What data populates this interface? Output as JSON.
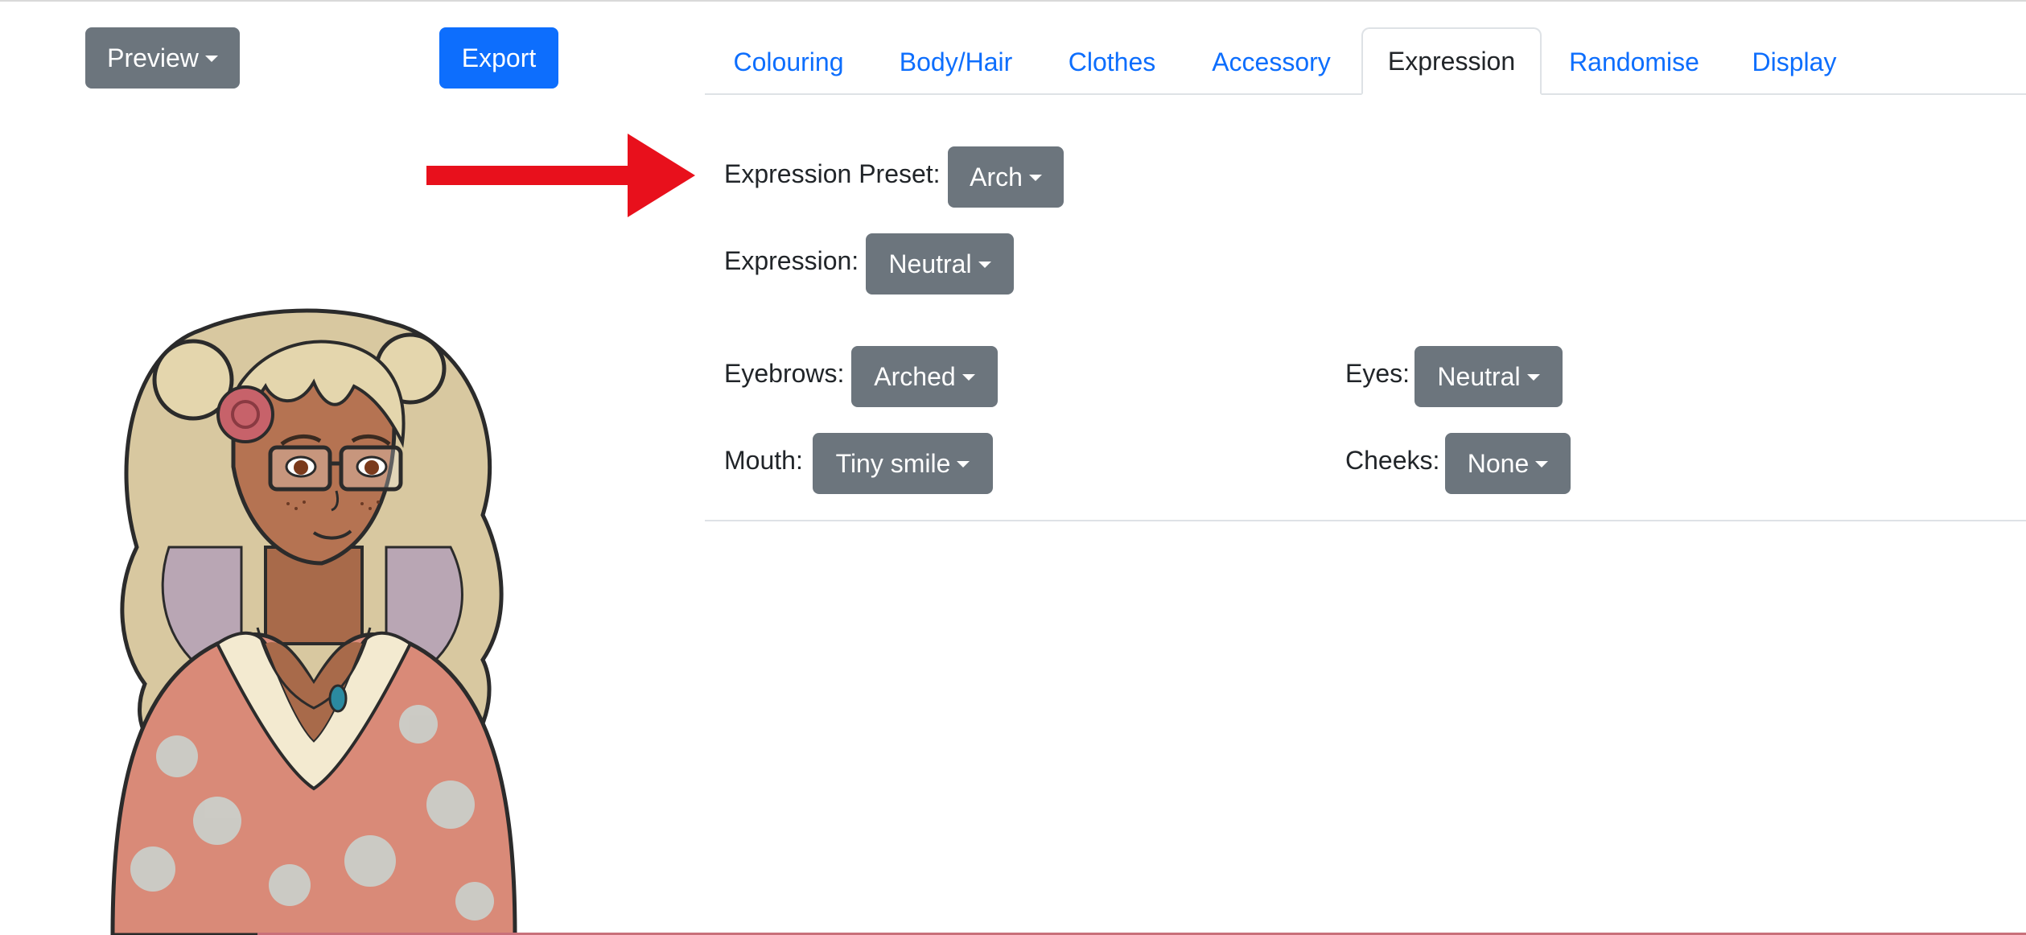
{
  "toolbar": {
    "preview_label": "Preview",
    "export_label": "Export"
  },
  "tabs": [
    {
      "label": "Colouring",
      "active": false
    },
    {
      "label": "Body/Hair",
      "active": false
    },
    {
      "label": "Clothes",
      "active": false
    },
    {
      "label": "Accessory",
      "active": false
    },
    {
      "label": "Expression",
      "active": true
    },
    {
      "label": "Randomise",
      "active": false
    },
    {
      "label": "Display",
      "active": false
    }
  ],
  "expression_panel": {
    "preset": {
      "label": "Expression Preset:",
      "value": "Arch"
    },
    "expression": {
      "label": "Expression:",
      "value": "Neutral"
    },
    "eyebrows": {
      "label": "Eyebrows:",
      "value": "Arched"
    },
    "eyes": {
      "label": "Eyes:",
      "value": "Neutral"
    },
    "mouth": {
      "label": "Mouth:",
      "value": "Tiny smile"
    },
    "cheeks": {
      "label": "Cheeks:",
      "value": "None"
    }
  },
  "colors": {
    "primary": "#0d6efd",
    "secondary": "#6c757d",
    "arrow": "#e8101c"
  },
  "icons": [
    "caret-down-icon",
    "red-arrow-annotation",
    "character-avatar"
  ]
}
